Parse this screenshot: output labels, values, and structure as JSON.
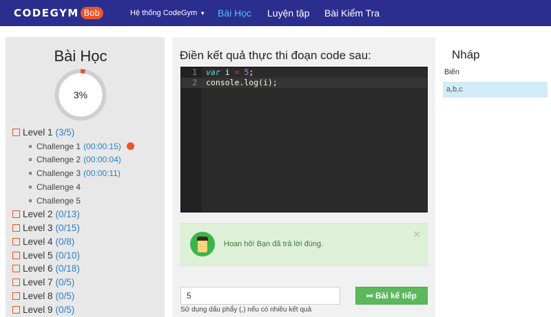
{
  "navbar": {
    "logo_text": "CODEGYM",
    "logo_badge": "Bob",
    "menu": {
      "system_label": "Hệ thống CodeGym",
      "lessons_label": "Bài Học",
      "practice_label": "Luyện tập",
      "tests_label": "Bài Kiểm Tra"
    },
    "active_color": "#4fc3f7",
    "background_color": "#2b2d8f"
  },
  "sidebar": {
    "title": "Bài Học",
    "progress": {
      "label": "3%",
      "value": 0.03
    },
    "levels": [
      {
        "label": "Level 1",
        "count": "(3/5)"
      },
      {
        "label": "Level 2",
        "count": "(0/13)"
      },
      {
        "label": "Level 3",
        "count": "(0/15)"
      },
      {
        "label": "Level 4",
        "count": "(0/8)"
      },
      {
        "label": "Level 5",
        "count": "(0/10)"
      },
      {
        "label": "Level 6",
        "count": "(0/18)"
      },
      {
        "label": "Level 7",
        "count": "(0/5)"
      },
      {
        "label": "Level 8",
        "count": "(0/5)"
      },
      {
        "label": "Level 9",
        "count": "(0/5)"
      }
    ],
    "challenges": [
      {
        "label": "Challenge 1",
        "time": "(00:00:15)"
      },
      {
        "label": "Challenge 2",
        "time": "(00:00:04)"
      },
      {
        "label": "Challenge 3",
        "time": "(00:00:11)"
      },
      {
        "label": "Challenge 4",
        "time": ""
      },
      {
        "label": "Challenge 5",
        "time": ""
      }
    ]
  },
  "main": {
    "question": "Điền kết quả thực thi đoạn code sau:",
    "code": {
      "line_numbers": [
        "1",
        "2"
      ],
      "line1": {
        "keyword": "var",
        "rest_a": " i ",
        "operator": "=",
        "rest_b": " ",
        "number": "5",
        "end": ";"
      },
      "line2": {
        "text": "console.log(i);"
      }
    },
    "alert": {
      "message": "Hoan hô! Bạn đã trả lời đúng.",
      "close": "×"
    },
    "answer": {
      "value": "5"
    },
    "next_button": {
      "icon": "⏭",
      "label": "Bài kế tiếp"
    },
    "hint": "Sử dụng dấu phẩy (,) nếu có nhiều kết quả"
  },
  "draft": {
    "title": "Nháp",
    "variables_label": "Biến",
    "variables_value": "a,b,c"
  }
}
